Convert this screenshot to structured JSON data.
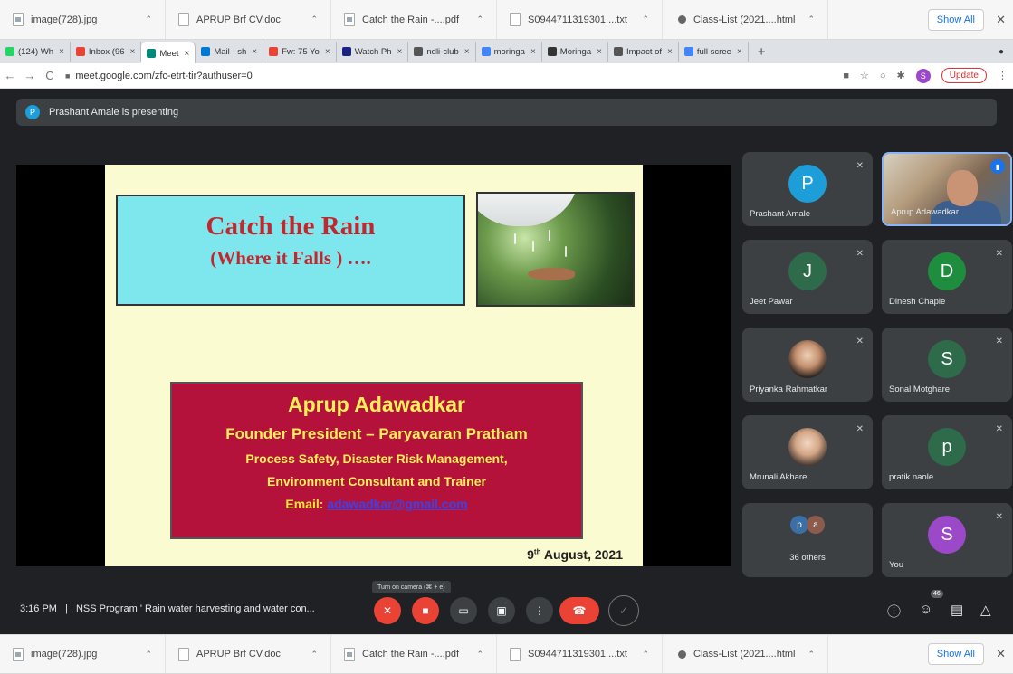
{
  "downloads": {
    "items": [
      {
        "name": "image(728).jpg",
        "icon": "image-file-icon"
      },
      {
        "name": "APRUP Brf CV.doc",
        "icon": "document-file-icon"
      },
      {
        "name": "Catch the Rain -....pdf",
        "icon": "image-file-icon"
      },
      {
        "name": "S0944711319301....txt",
        "icon": "document-file-icon"
      },
      {
        "name": "Class-List (2021....html",
        "icon": "html-file-icon"
      }
    ],
    "show_all": "Show All",
    "close": "✕"
  },
  "tabs": [
    {
      "label": "(124) Wh",
      "color": "#25d366"
    },
    {
      "label": "Inbox (96",
      "color": "#ea4335"
    },
    {
      "label": "Meet",
      "color": "#00897b",
      "active": true
    },
    {
      "label": "Mail - sh",
      "color": "#0078d4"
    },
    {
      "label": "Fw: 75 Yo",
      "color": "#ea4335"
    },
    {
      "label": "Watch Ph",
      "color": "#1a237e"
    },
    {
      "label": "ndli-club",
      "color": "#555555"
    },
    {
      "label": "moringa",
      "color": "#4285f4"
    },
    {
      "label": "Moringa",
      "color": "#333333"
    },
    {
      "label": "Impact of",
      "color": "#555555"
    },
    {
      "label": "full scree",
      "color": "#4285f4"
    }
  ],
  "address": {
    "url": "meet.google.com/zfc-etrt-tir?authuser=0",
    "profile_initial": "S",
    "update_label": "Update"
  },
  "presenting": {
    "initial": "P",
    "text": "Prashant Amale is presenting"
  },
  "slide": {
    "title": "Catch the Rain",
    "subtitle": "(Where it Falls ) ….",
    "name": "Aprup Adawadkar",
    "role": "Founder President – Paryavaran Pratham",
    "line1": "Process Safety, Disaster Risk Management,",
    "line2": "Environment Consultant  and Trainer",
    "email_label": "Email:",
    "email_value": "adawadkar@gmail.com",
    "date_day": "9",
    "date_sup": "th",
    "date_rest": " August, 2021"
  },
  "participants": [
    {
      "name": "Prashant Amale",
      "initial": "P",
      "color": "#1e9ed8"
    },
    {
      "name": "Aprup Adawadkar",
      "video": true
    },
    {
      "name": "Jeet Pawar",
      "initial": "J",
      "color": "#2e6b4a"
    },
    {
      "name": "Dinesh Chaple",
      "initial": "D",
      "color": "#1e8e3e"
    },
    {
      "name": "Priyanka Rahmatkar",
      "photo": true
    },
    {
      "name": "Sonal Motghare",
      "initial": "S",
      "color": "#2e6b4a"
    },
    {
      "name": "Mrunali Akhare",
      "photo": true
    },
    {
      "name": "pratik naole",
      "initial": "p",
      "color": "#2e6b4a"
    },
    {
      "name": "36 others",
      "others": [
        "p",
        "a"
      ]
    },
    {
      "name": "You",
      "initial": "S",
      "color": "#9c49c9"
    }
  ],
  "controls": {
    "time": "3:16 PM",
    "separator": "|",
    "meeting_title": "NSS Program ' Rain water harvesting and water con...",
    "tooltip": "Turn on camera (⌘ + e)",
    "people_count": "46"
  }
}
